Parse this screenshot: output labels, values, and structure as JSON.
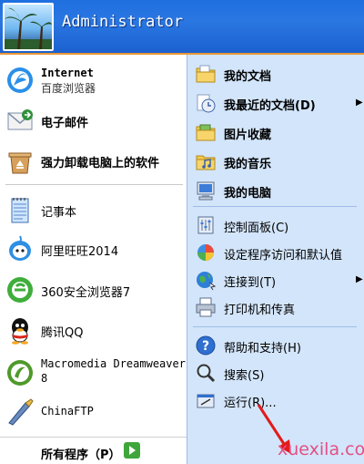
{
  "header": {
    "user_name": "Administrator"
  },
  "left_pane": {
    "pinned": [
      {
        "title": "Internet",
        "subtitle": "百度浏览器",
        "icon": "browser-icon"
      },
      {
        "title": "电子邮件",
        "subtitle": "",
        "icon": "email-icon"
      },
      {
        "title": "强力卸载电脑上的软件",
        "subtitle": "",
        "icon": "uninstall-icon"
      }
    ],
    "recent": [
      {
        "title": "记事本",
        "icon": "notepad-icon"
      },
      {
        "title": "阿里旺旺2014",
        "icon": "aliwangwang-icon"
      },
      {
        "title": "360安全浏览器7",
        "icon": "360-browser-icon"
      },
      {
        "title": "腾讯QQ",
        "icon": "qq-icon"
      },
      {
        "title": "Macromedia Dreamweaver",
        "title2": "8",
        "icon": "dreamweaver-icon"
      },
      {
        "title": "ChinaFTP",
        "icon": "chinaftp-icon"
      }
    ],
    "all_programs": {
      "label": "所有程序（P）",
      "icon": "green-arrow-icon"
    }
  },
  "right_pane": {
    "items": [
      {
        "label": "我的文档",
        "icon": "my-documents-icon",
        "bold": true
      },
      {
        "label": "我最近的文档(D)",
        "icon": "recent-documents-icon",
        "bold": true,
        "submenu": true
      },
      {
        "label": "图片收藏",
        "icon": "my-pictures-icon",
        "bold": true
      },
      {
        "label": "我的音乐",
        "icon": "my-music-icon",
        "bold": true
      },
      {
        "label": "我的电脑",
        "icon": "my-computer-icon",
        "bold": true
      },
      {
        "label": "控制面板(C)",
        "icon": "control-panel-icon"
      },
      {
        "label": "设定程序访问和默认值",
        "icon": "program-defaults-icon"
      },
      {
        "label": "连接到(T)",
        "icon": "connect-to-icon",
        "submenu": true
      },
      {
        "label": "打印机和传真",
        "icon": "printer-icon"
      },
      {
        "label": "帮助和支持(H)",
        "icon": "help-icon"
      },
      {
        "label": "搜索(S)",
        "icon": "search-icon"
      },
      {
        "label": "运行(R)...",
        "icon": "run-icon"
      }
    ]
  },
  "watermark": "xuexila.com",
  "colors": {
    "header_blue": "#1f6fe0",
    "right_pane_bg": "#d3e5fa",
    "header_accent": "#e99636",
    "watermark": "#e44f84"
  }
}
